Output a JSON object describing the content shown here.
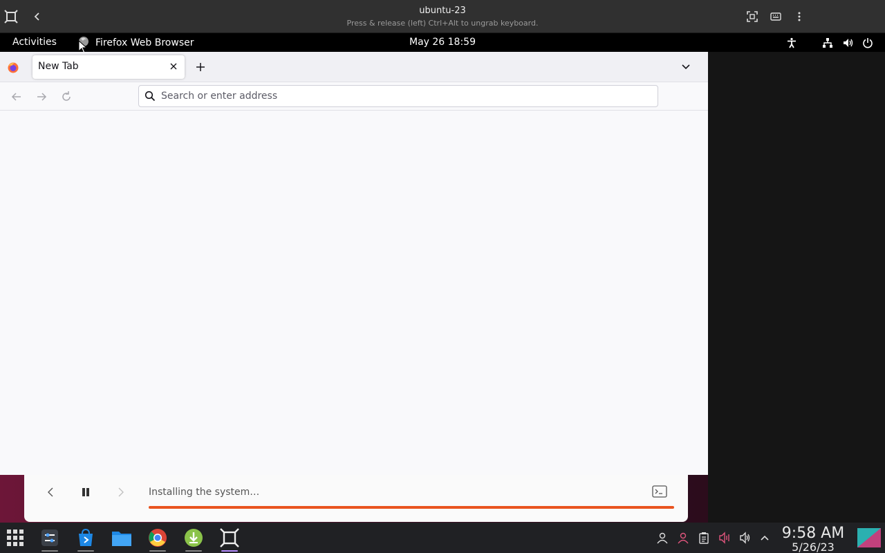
{
  "vm_header": {
    "title": "ubuntu-23",
    "subtitle": "Press & release (left) Ctrl+Alt to ungrab keyboard.",
    "icons": [
      "vm-app-icon",
      "back-icon",
      "fullscreen-icon",
      "keyboard-icon",
      "kebab-menu-icon"
    ]
  },
  "guest_topbar": {
    "activities": "Activities",
    "app_menu": "Firefox Web Browser",
    "clock": "May 26  18:59",
    "icons": [
      "accessibility-icon",
      "network-icon",
      "volume-icon",
      "power-icon"
    ]
  },
  "firefox": {
    "tab_title": "New Tab",
    "address_placeholder": "Search or enter address",
    "icons": [
      "firefox-logo",
      "close-icon",
      "plus-icon",
      "chevron-down-icon",
      "back-arrow-icon",
      "forward-arrow-icon",
      "reload-icon",
      "search-icon"
    ]
  },
  "installer": {
    "status": "Installing the system…",
    "progress": 1.0,
    "colors": {
      "accent": "#e95420"
    },
    "icons": [
      "chevron-left-icon",
      "pause-icon",
      "chevron-right-icon",
      "terminal-icon"
    ]
  },
  "taskbar": {
    "time": "9:58 AM",
    "date": "5/26/23",
    "apps": [
      "app-grid-icon",
      "settings-icon",
      "store-icon",
      "files-icon",
      "chrome-icon",
      "download-app-icon",
      "vm-app-icon"
    ],
    "tray": [
      "user-icon",
      "user-alt-icon",
      "clipboard-icon",
      "mic-muted-icon",
      "volume-icon",
      "chevron-up-icon"
    ]
  }
}
